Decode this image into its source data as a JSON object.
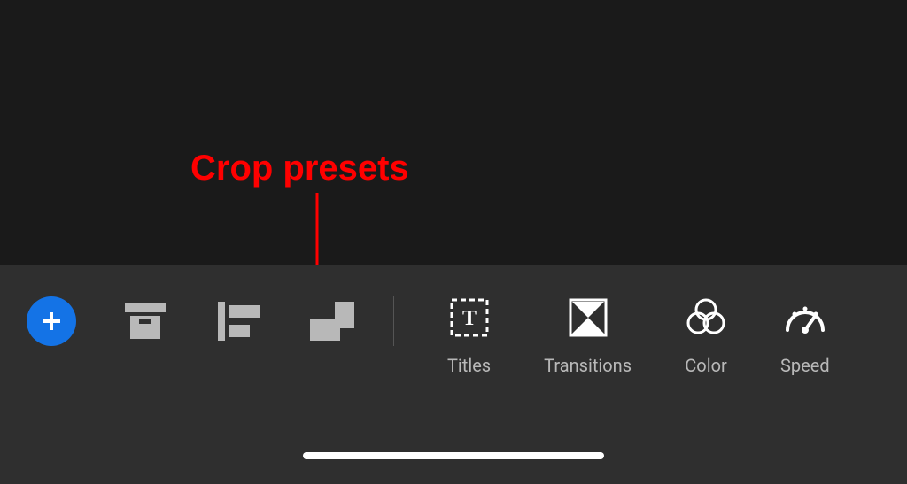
{
  "annotation": {
    "label": "Crop presets"
  },
  "toolbar": {
    "tools": {
      "titles": {
        "label": "Titles"
      },
      "transitions": {
        "label": "Transitions"
      },
      "color": {
        "label": "Color"
      },
      "speed": {
        "label": "Speed"
      }
    }
  },
  "colors": {
    "accent_blue": "#1473e6",
    "annotation_red": "#ff0000",
    "background_dark": "#1a1a1a",
    "toolbar_bg": "#2f2f2f",
    "icon_gray": "#b8b8b8"
  }
}
